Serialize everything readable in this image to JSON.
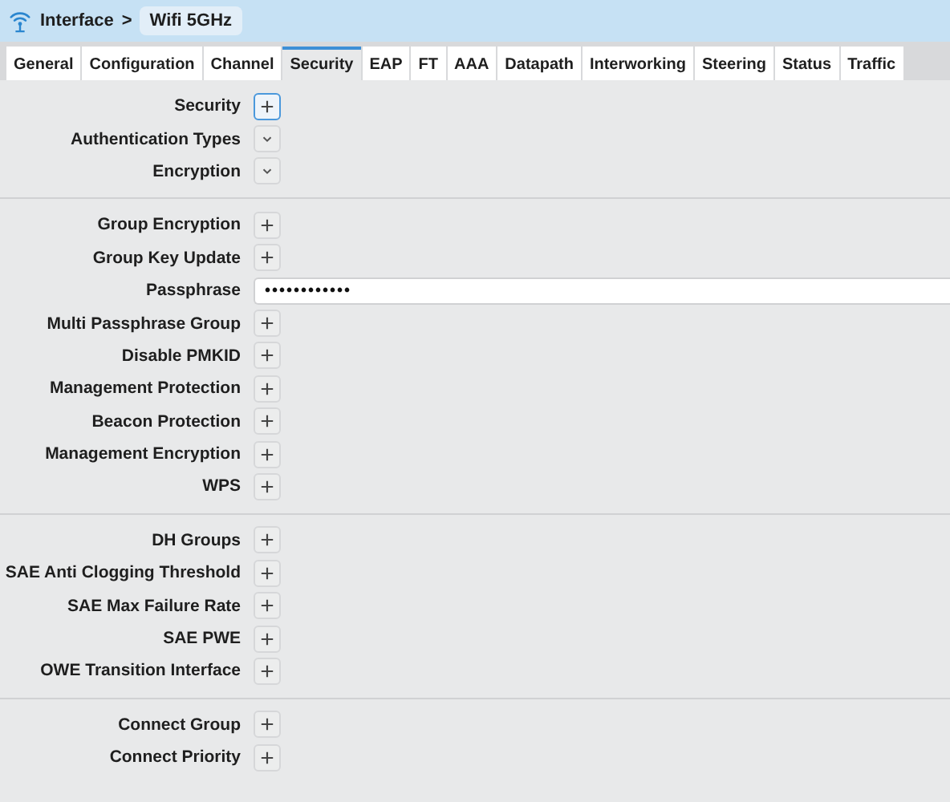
{
  "breadcrumb": {
    "parent": "Interface",
    "separator": ">",
    "current": "Wifi 5GHz"
  },
  "tabs": [
    {
      "label": "General",
      "selected": false
    },
    {
      "label": "Configuration",
      "selected": false
    },
    {
      "label": "Channel",
      "selected": false
    },
    {
      "label": "Security",
      "selected": true
    },
    {
      "label": "EAP",
      "selected": false
    },
    {
      "label": "FT",
      "selected": false
    },
    {
      "label": "AAA",
      "selected": false
    },
    {
      "label": "Datapath",
      "selected": false
    },
    {
      "label": "Interworking",
      "selected": false
    },
    {
      "label": "Steering",
      "selected": false
    },
    {
      "label": "Status",
      "selected": false
    },
    {
      "label": "Traffic",
      "selected": false
    }
  ],
  "sections": [
    {
      "rows": [
        {
          "label": "Security",
          "kind": "add",
          "focused": true
        },
        {
          "label": "Authentication Types",
          "kind": "expand",
          "focused": false
        },
        {
          "label": "Encryption",
          "kind": "expand",
          "focused": false
        }
      ]
    },
    {
      "rows": [
        {
          "label": "Group Encryption",
          "kind": "add",
          "focused": false
        },
        {
          "label": "Group Key Update",
          "kind": "add",
          "focused": false
        },
        {
          "label": "Passphrase",
          "kind": "password",
          "value": "••••••••••••",
          "focused": false
        },
        {
          "label": "Multi Passphrase Group",
          "kind": "add",
          "focused": false
        },
        {
          "label": "Disable PMKID",
          "kind": "add",
          "focused": false
        },
        {
          "label": "Management Protection",
          "kind": "add",
          "focused": false
        },
        {
          "label": "Beacon Protection",
          "kind": "add",
          "focused": false
        },
        {
          "label": "Management Encryption",
          "kind": "add",
          "focused": false
        },
        {
          "label": "WPS",
          "kind": "add",
          "focused": false
        }
      ]
    },
    {
      "rows": [
        {
          "label": "DH Groups",
          "kind": "add",
          "focused": false
        },
        {
          "label": "SAE Anti Clogging Threshold",
          "kind": "add",
          "focused": false
        },
        {
          "label": "SAE Max Failure Rate",
          "kind": "add",
          "focused": false
        },
        {
          "label": "SAE PWE",
          "kind": "add",
          "focused": false
        },
        {
          "label": "OWE Transition Interface",
          "kind": "add",
          "focused": false
        }
      ]
    },
    {
      "rows": [
        {
          "label": "Connect Group",
          "kind": "add",
          "focused": false
        },
        {
          "label": "Connect Priority",
          "kind": "add",
          "focused": false
        }
      ]
    }
  ]
}
